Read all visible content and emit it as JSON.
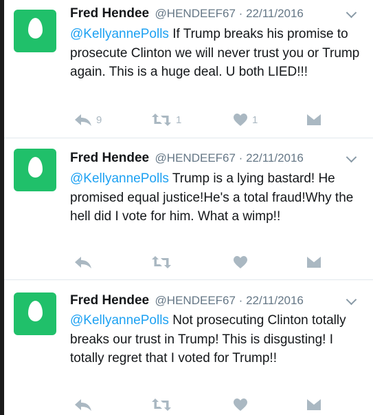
{
  "tweets": [
    {
      "name": "Fred Hendee",
      "handle": "@HENDEEF67",
      "separator": " · ",
      "date": "22/11/2016",
      "mention": "@KellyannePolls",
      "text": " If Trump breaks his promise to prosecute Clinton we will never trust you or Trump again. This is a huge deal. U both LIED!!!",
      "reply_count": "9",
      "retweet_count": "1",
      "like_count": "1"
    },
    {
      "name": "Fred Hendee",
      "handle": "@HENDEEF67",
      "separator": " · ",
      "date": "22/11/2016",
      "mention": "@KellyannePolls",
      "text": " Trump is a lying bastard! He promised equal justice!He's a total fraud!Why the hell did I vote for him. What a wimp!!",
      "reply_count": "",
      "retweet_count": "",
      "like_count": ""
    },
    {
      "name": "Fred Hendee",
      "handle": "@HENDEEF67",
      "separator": " · ",
      "date": "22/11/2016",
      "mention": "@KellyannePolls",
      "text": " Not prosecuting Clinton totally breaks our trust in Trump! This is disgusting! I totally regret that I voted for Trump!!",
      "reply_count": "",
      "retweet_count": "",
      "like_count": ""
    }
  ],
  "icons": {
    "reply": "reply-icon",
    "retweet": "retweet-icon",
    "like": "heart-icon",
    "dm": "envelope-icon",
    "menu": "chevron-down-icon",
    "avatar": "default-egg-avatar"
  },
  "colors": {
    "name": "#14171a",
    "meta": "#657786",
    "mention": "#1da1f2",
    "icons": "#aab8c2",
    "avatar_bg": "#20c06a",
    "divider": "#e1e8ed"
  }
}
